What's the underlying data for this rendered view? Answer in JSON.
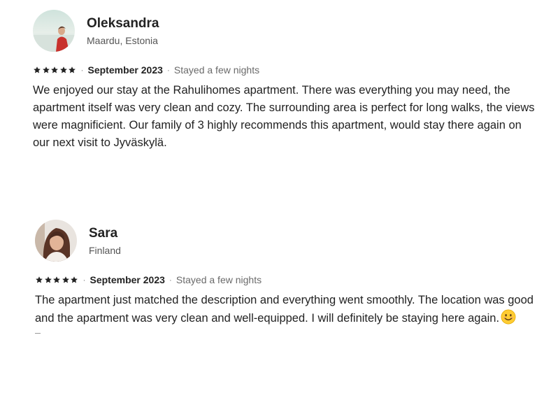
{
  "reviews": [
    {
      "name": "Oleksandra",
      "location": "Maardu, Estonia",
      "rating": 5,
      "date": "September 2023",
      "stay": "Stayed a few nights",
      "text": "We enjoyed our stay at the Rahulihomes apartment. There was everything you may need, the apartment itself was very clean and cozy. The surrounding area is perfect for long walks, the views were magnificient. Our family of 3 highly recommends this apartment, would stay there again on our next visit to Jyväskylä."
    },
    {
      "name": "Sara",
      "location": "Finland",
      "rating": 5,
      "date": "September 2023",
      "stay": "Stayed a few nights",
      "text": "The apartment just matched the description and everything went smoothly. The location was good and the apartment was very clean and well-equipped. I will definitely be staying here again."
    }
  ],
  "separator": "·",
  "icons": {
    "star": "star-icon",
    "emoji": "smiling-face-emoji"
  },
  "colors": {
    "text": "#222222",
    "muted": "#6a6a6a",
    "star": "#222222"
  }
}
